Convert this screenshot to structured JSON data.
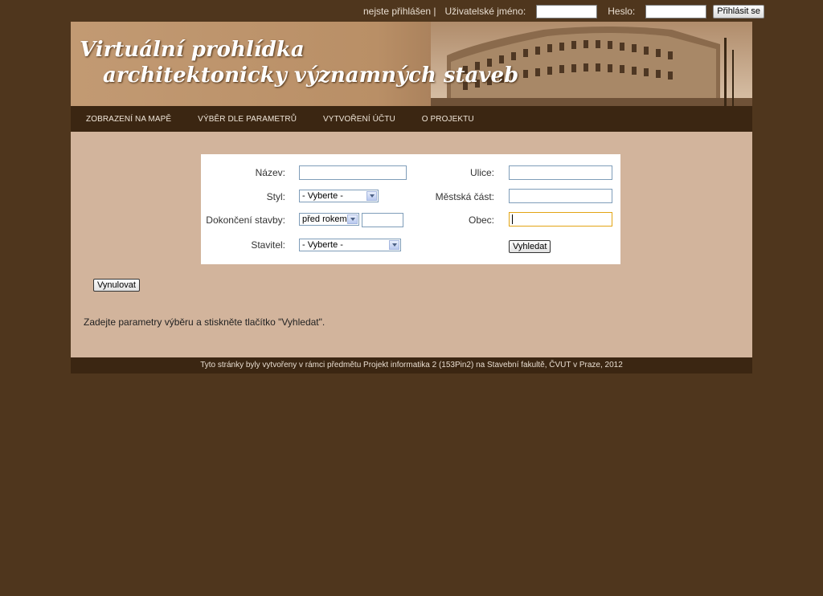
{
  "login": {
    "status": "nejste přihlášen |",
    "username_label": "Uživatelské jméno:",
    "username_value": "",
    "password_label": "Heslo:",
    "password_value": "",
    "submit": "Přihlásit se"
  },
  "banner": {
    "title_line1": "Virtuální prohlídka",
    "title_line2": "architektonicky významných staveb"
  },
  "nav": {
    "items": [
      "ZOBRAZENÍ NA MAPĚ",
      "VÝBĚR DLE PARAMETRŮ",
      "VYTVOŘENÍ ÚČTU",
      "O PROJEKTU"
    ]
  },
  "form": {
    "nazev_label": "Název:",
    "nazev_value": "",
    "styl_label": "Styl:",
    "styl_value": "- Vyberte -",
    "dokonceni_label": "Dokončení stavby:",
    "dokonceni_mode": "před rokem",
    "dokonceni_year": "",
    "stavitel_label": "Stavitel:",
    "stavitel_value": "- Vyberte -",
    "ulice_label": "Ulice:",
    "ulice_value": "",
    "mestska_cast_label": "Městská část:",
    "mestska_cast_value": "",
    "obec_label": "Obec:",
    "obec_value": "",
    "search_button": "Vyhledat"
  },
  "reset_button": "Vynulovat",
  "hint": "Zadejte parametry výběru a stiskněte tlačítko \"Vyhledat\".",
  "footer": "Tyto stránky byly vytvořeny v rámci předmětu Projekt informatika 2 (153Pin2) na Stavební fakultě, ČVUT v Praze, 2012",
  "colors": {
    "page_background": "#4f361d",
    "nav_background": "#3b2612",
    "content_background": "#d2b49c",
    "focus_border": "#e3a514"
  }
}
